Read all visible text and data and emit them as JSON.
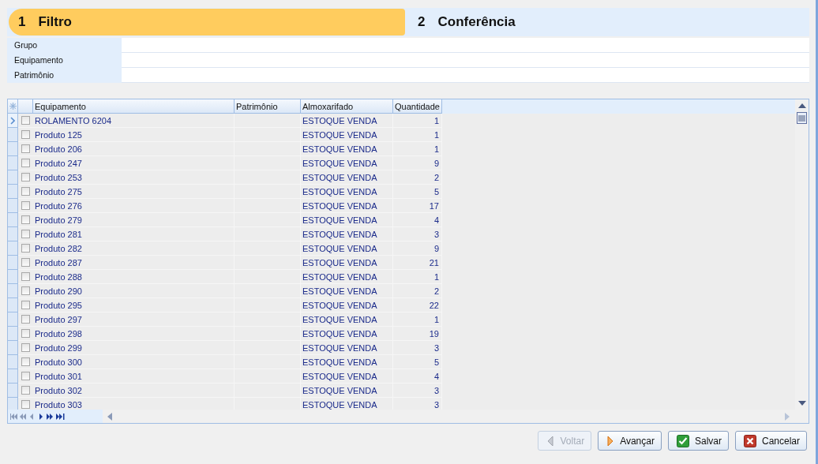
{
  "steps": [
    {
      "number": "1",
      "label": "Filtro",
      "selected": true
    },
    {
      "number": "2",
      "label": "Conferência",
      "selected": false
    }
  ],
  "filters": [
    {
      "label": "Grupo"
    },
    {
      "label": "Equipamento"
    },
    {
      "label": "Patrimônio"
    }
  ],
  "table": {
    "columns": [
      "Equipamento",
      "Patrimônio",
      "Almoxarifado",
      "Quantidade"
    ],
    "rows": [
      {
        "equipamento": "ROLAMENTO 6204",
        "almoxarifado": "ESTOQUE VENDA",
        "quantidade": "1",
        "selected": true,
        "checked": false
      },
      {
        "equipamento": "Produto 125",
        "almoxarifado": "ESTOQUE VENDA",
        "quantidade": "1",
        "selected": false,
        "checked": false
      },
      {
        "equipamento": "Produto 206",
        "almoxarifado": "ESTOQUE VENDA",
        "quantidade": "1",
        "selected": false,
        "checked": false
      },
      {
        "equipamento": "Produto 247",
        "almoxarifado": "ESTOQUE VENDA",
        "quantidade": "9",
        "selected": false,
        "checked": false
      },
      {
        "equipamento": "Produto 253",
        "almoxarifado": "ESTOQUE VENDA",
        "quantidade": "2",
        "selected": false,
        "checked": false
      },
      {
        "equipamento": "Produto 275",
        "almoxarifado": "ESTOQUE VENDA",
        "quantidade": "5",
        "selected": false,
        "checked": false
      },
      {
        "equipamento": "Produto 276",
        "almoxarifado": "ESTOQUE VENDA",
        "quantidade": "17",
        "selected": false,
        "checked": false
      },
      {
        "equipamento": "Produto 279",
        "almoxarifado": "ESTOQUE VENDA",
        "quantidade": "4",
        "selected": false,
        "checked": false
      },
      {
        "equipamento": "Produto 281",
        "almoxarifado": "ESTOQUE VENDA",
        "quantidade": "3",
        "selected": false,
        "checked": false
      },
      {
        "equipamento": "Produto 282",
        "almoxarifado": "ESTOQUE VENDA",
        "quantidade": "9",
        "selected": false,
        "checked": false
      },
      {
        "equipamento": "Produto 287",
        "almoxarifado": "ESTOQUE VENDA",
        "quantidade": "21",
        "selected": false,
        "checked": false
      },
      {
        "equipamento": "Produto 288",
        "almoxarifado": "ESTOQUE VENDA",
        "quantidade": "1",
        "selected": false,
        "checked": false
      },
      {
        "equipamento": "Produto 290",
        "almoxarifado": "ESTOQUE VENDA",
        "quantidade": "2",
        "selected": false,
        "checked": false
      },
      {
        "equipamento": "Produto 295",
        "almoxarifado": "ESTOQUE VENDA",
        "quantidade": "22",
        "selected": false,
        "checked": false
      },
      {
        "equipamento": "Produto 297",
        "almoxarifado": "ESTOQUE VENDA",
        "quantidade": "1",
        "selected": false,
        "checked": false
      },
      {
        "equipamento": "Produto 298",
        "almoxarifado": "ESTOQUE VENDA",
        "quantidade": "19",
        "selected": false,
        "checked": false
      },
      {
        "equipamento": "Produto 299",
        "almoxarifado": "ESTOQUE VENDA",
        "quantidade": "3",
        "selected": false,
        "checked": false
      },
      {
        "equipamento": "Produto 300",
        "almoxarifado": "ESTOQUE VENDA",
        "quantidade": "5",
        "selected": false,
        "checked": false
      },
      {
        "equipamento": "Produto 301",
        "almoxarifado": "ESTOQUE VENDA",
        "quantidade": "4",
        "selected": false,
        "checked": false
      },
      {
        "equipamento": "Produto 302",
        "almoxarifado": "ESTOQUE VENDA",
        "quantidade": "3",
        "selected": false,
        "checked": false
      },
      {
        "equipamento": "Produto 303",
        "almoxarifado": "ESTOQUE VENDA",
        "quantidade": "3",
        "selected": false,
        "checked": false
      }
    ]
  },
  "buttons": [
    {
      "kind": "back",
      "label": "Voltar",
      "disabled": true
    },
    {
      "kind": "next",
      "label": "Avançar",
      "disabled": false
    },
    {
      "kind": "save",
      "label": "Salvar",
      "disabled": false
    },
    {
      "kind": "cancel",
      "label": "Cancelar",
      "disabled": false
    }
  ]
}
